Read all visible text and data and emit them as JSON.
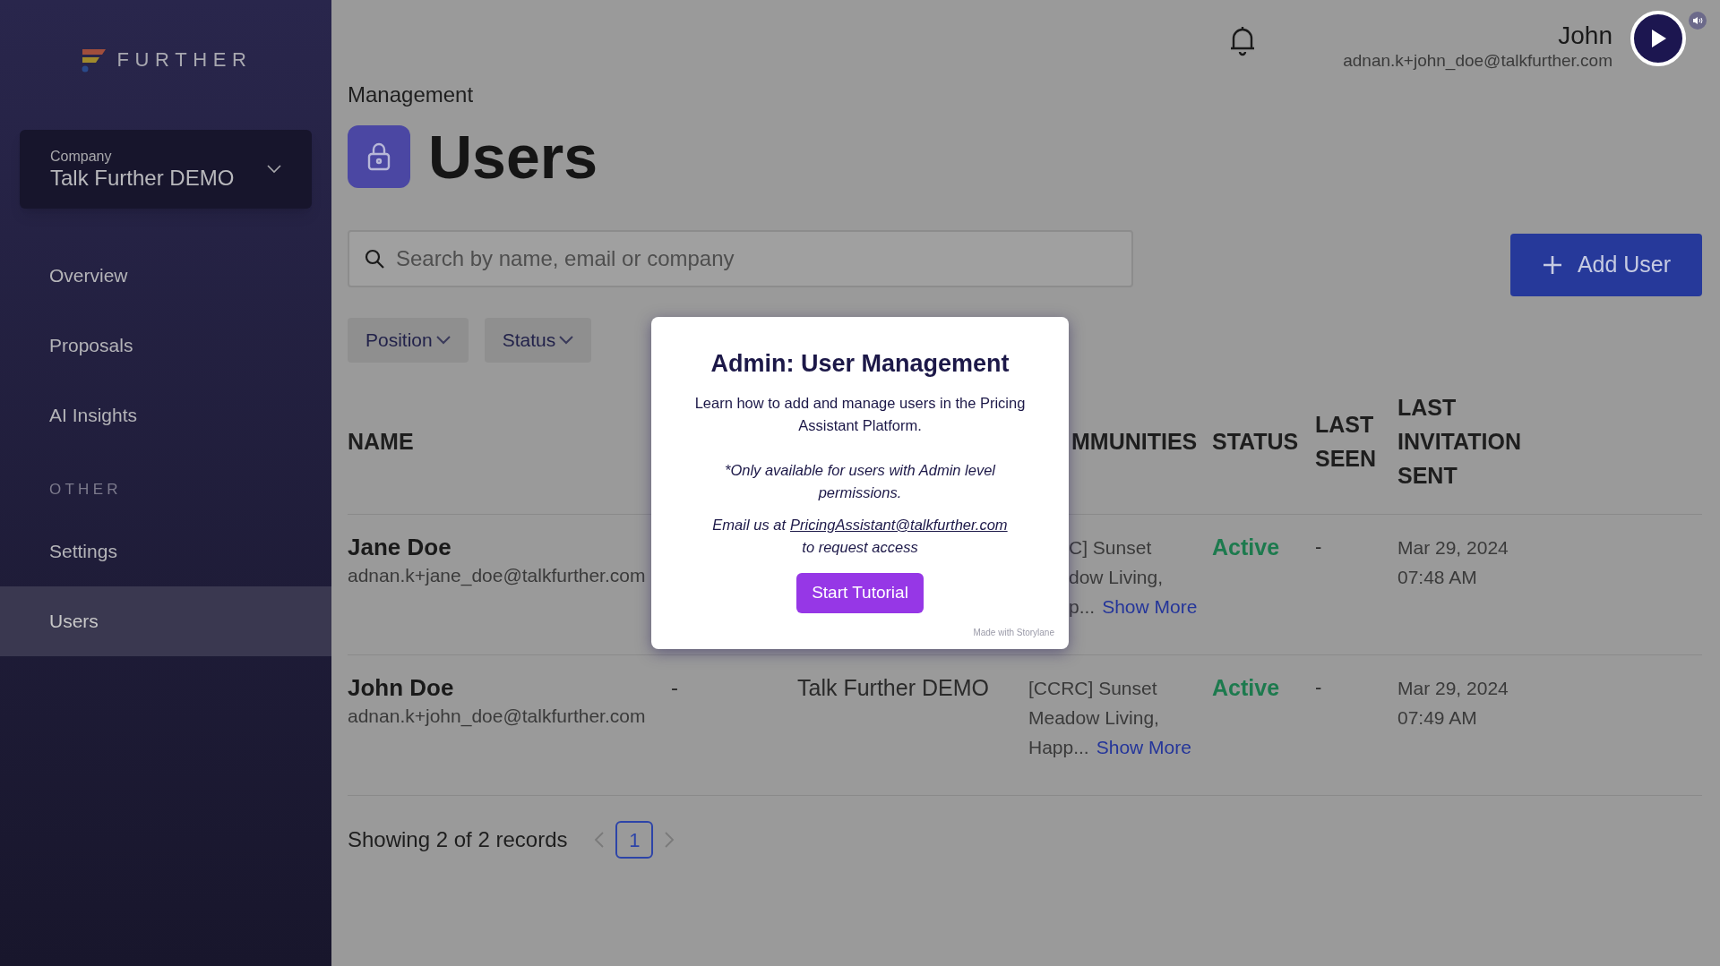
{
  "sidebar": {
    "logo": "FURTHER",
    "company_selector": {
      "label": "Company",
      "value": "Talk Further DEMO"
    },
    "items": [
      {
        "label": "Overview",
        "selected": false
      },
      {
        "label": "Proposals",
        "selected": false
      },
      {
        "label": "AI Insights",
        "selected": false
      }
    ],
    "section_label": "OTHER",
    "other_items": [
      {
        "label": "Settings",
        "selected": false
      },
      {
        "label": "Users",
        "selected": true
      }
    ]
  },
  "header": {
    "user_name": "John",
    "user_email": "adnan.k+john_doe@talkfurther.com"
  },
  "page": {
    "breadcrumb": "Management",
    "title": "Users",
    "search": {
      "placeholder": "Search by name, email or company"
    },
    "add_button": "Add User",
    "filters": [
      "Position",
      "Status"
    ]
  },
  "table": {
    "columns": {
      "name": "NAME",
      "communities": "MMUNITIES",
      "status": "STATUS",
      "last_seen": "LAST SEEN",
      "last_invitation_sent": "LAST INVITATION SENT"
    },
    "rows": [
      {
        "name": "Jane Doe",
        "email": "adnan.k+jane_doe@talkfurther.com",
        "communities": {
          "cut": true,
          "lines": [
            "C] Sunset",
            "dow Living,",
            "p..."
          ],
          "link": "Show More"
        },
        "status": {
          "label": "Active",
          "kind": "active"
        },
        "last_seen": "-",
        "last_invitation_sent": [
          "Mar 29, 2024",
          "07:48 AM"
        ]
      },
      {
        "name": "John Doe",
        "email": "adnan.k+john_doe@talkfurther.com",
        "position": "-",
        "company": "Talk Further DEMO",
        "communities": {
          "cut": false,
          "lines": [
            "[CCRC] Sunset",
            "Meadow Living,",
            "Happ..."
          ],
          "link": "Show More"
        },
        "status": {
          "label": "Active",
          "kind": "active"
        },
        "last_seen": "-",
        "last_invitation_sent": [
          "Mar 29, 2024",
          "07:49 AM"
        ]
      }
    ]
  },
  "pagination": {
    "summary": "Showing 2 of 2 records",
    "pages": [
      {
        "label": "1",
        "selected": true
      }
    ]
  },
  "modal": {
    "title": "Admin: User Management",
    "body": "Learn how to add and manage users in the Pricing Assistant Platform.",
    "note": "*Only available for users with Admin level permissions.",
    "email_prefix": "Email us at",
    "email": "PricingAssistant@talkfurther.com",
    "email_suffix": "to request access",
    "button": "Start Tutorial",
    "footer": "Made with Storylane"
  }
}
